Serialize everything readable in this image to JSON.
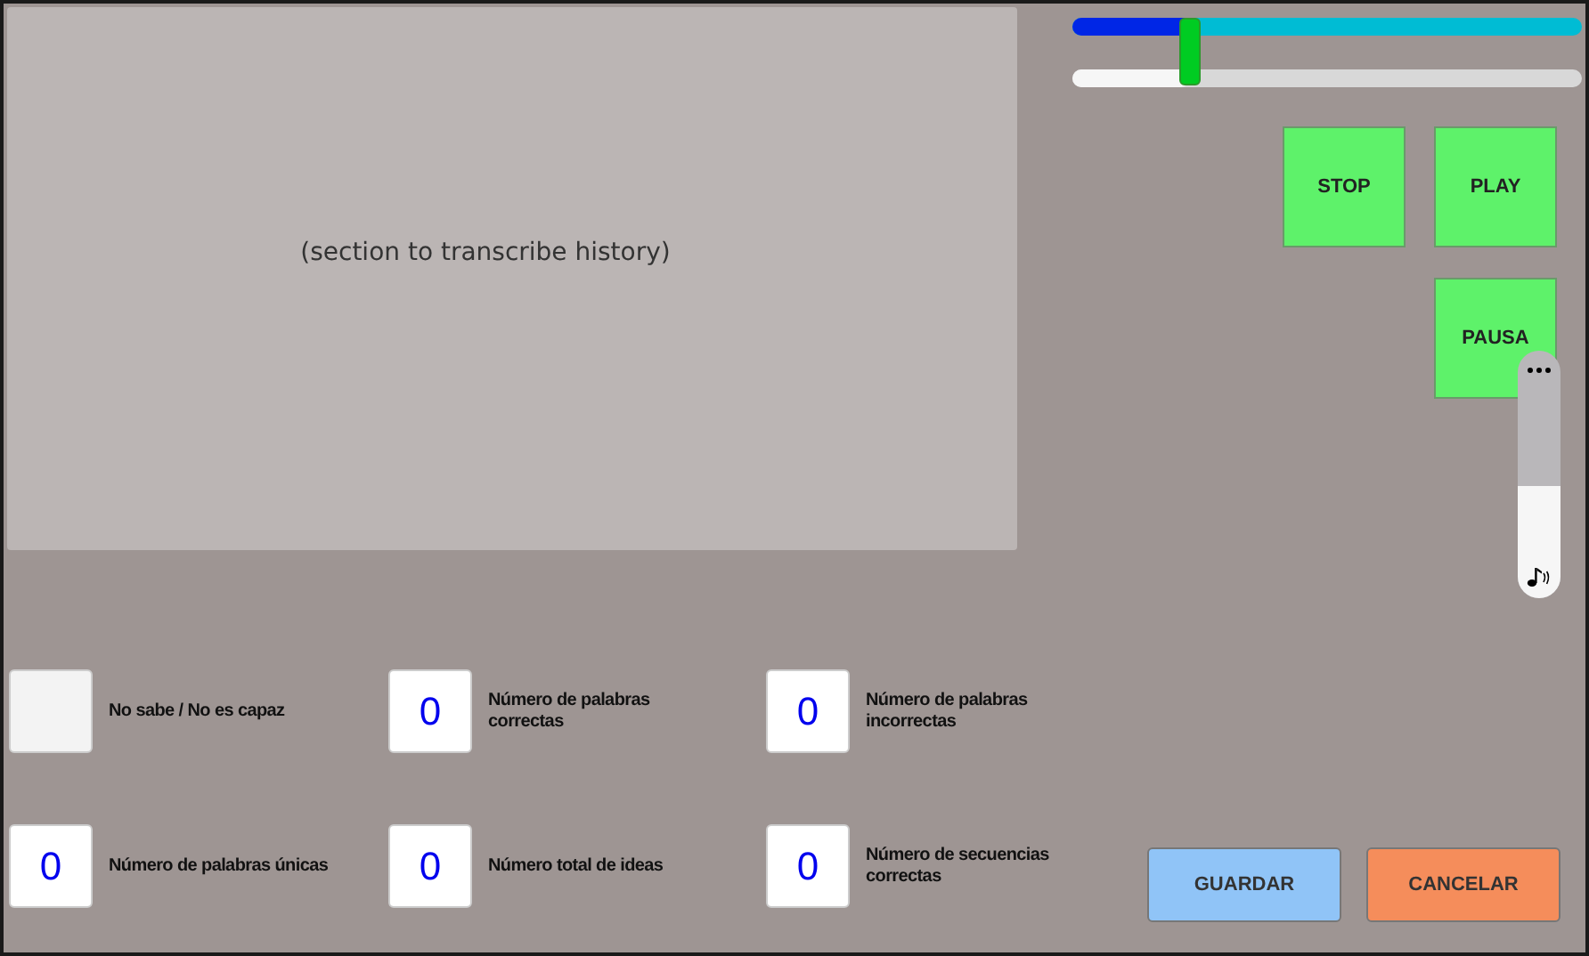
{
  "transcript": {
    "placeholder": "(section to transcribe history)"
  },
  "sliders": [
    {
      "kind": "progress",
      "level": 0.25
    },
    {
      "kind": "seek",
      "level": 0.23
    }
  ],
  "controls": [
    {
      "kind": "stop",
      "label": "STOP"
    },
    {
      "kind": "play",
      "label": "PLAY"
    },
    {
      "kind": "pause",
      "label": "PAUSA"
    }
  ],
  "volume": {
    "level": 0.45
  },
  "fields": [
    {
      "kind": "checkbox",
      "label": "No sabe / No es capaz",
      "checked": false
    },
    {
      "kind": "counter",
      "label": "Número de palabras correctas",
      "value": "0"
    },
    {
      "kind": "counter",
      "label": "Número de palabras incorrectas",
      "value": "0"
    },
    {
      "kind": "counter",
      "label": "Número de palabras únicas",
      "value": "0"
    },
    {
      "kind": "counter",
      "label": "Número total de ideas",
      "value": "0"
    },
    {
      "kind": "counter",
      "label": "Número de secuencias correctas",
      "value": "0"
    }
  ],
  "buttons": [
    {
      "kind": "save",
      "label": "GUARDAR"
    },
    {
      "kind": "cancel",
      "label": "CANCELAR"
    }
  ]
}
